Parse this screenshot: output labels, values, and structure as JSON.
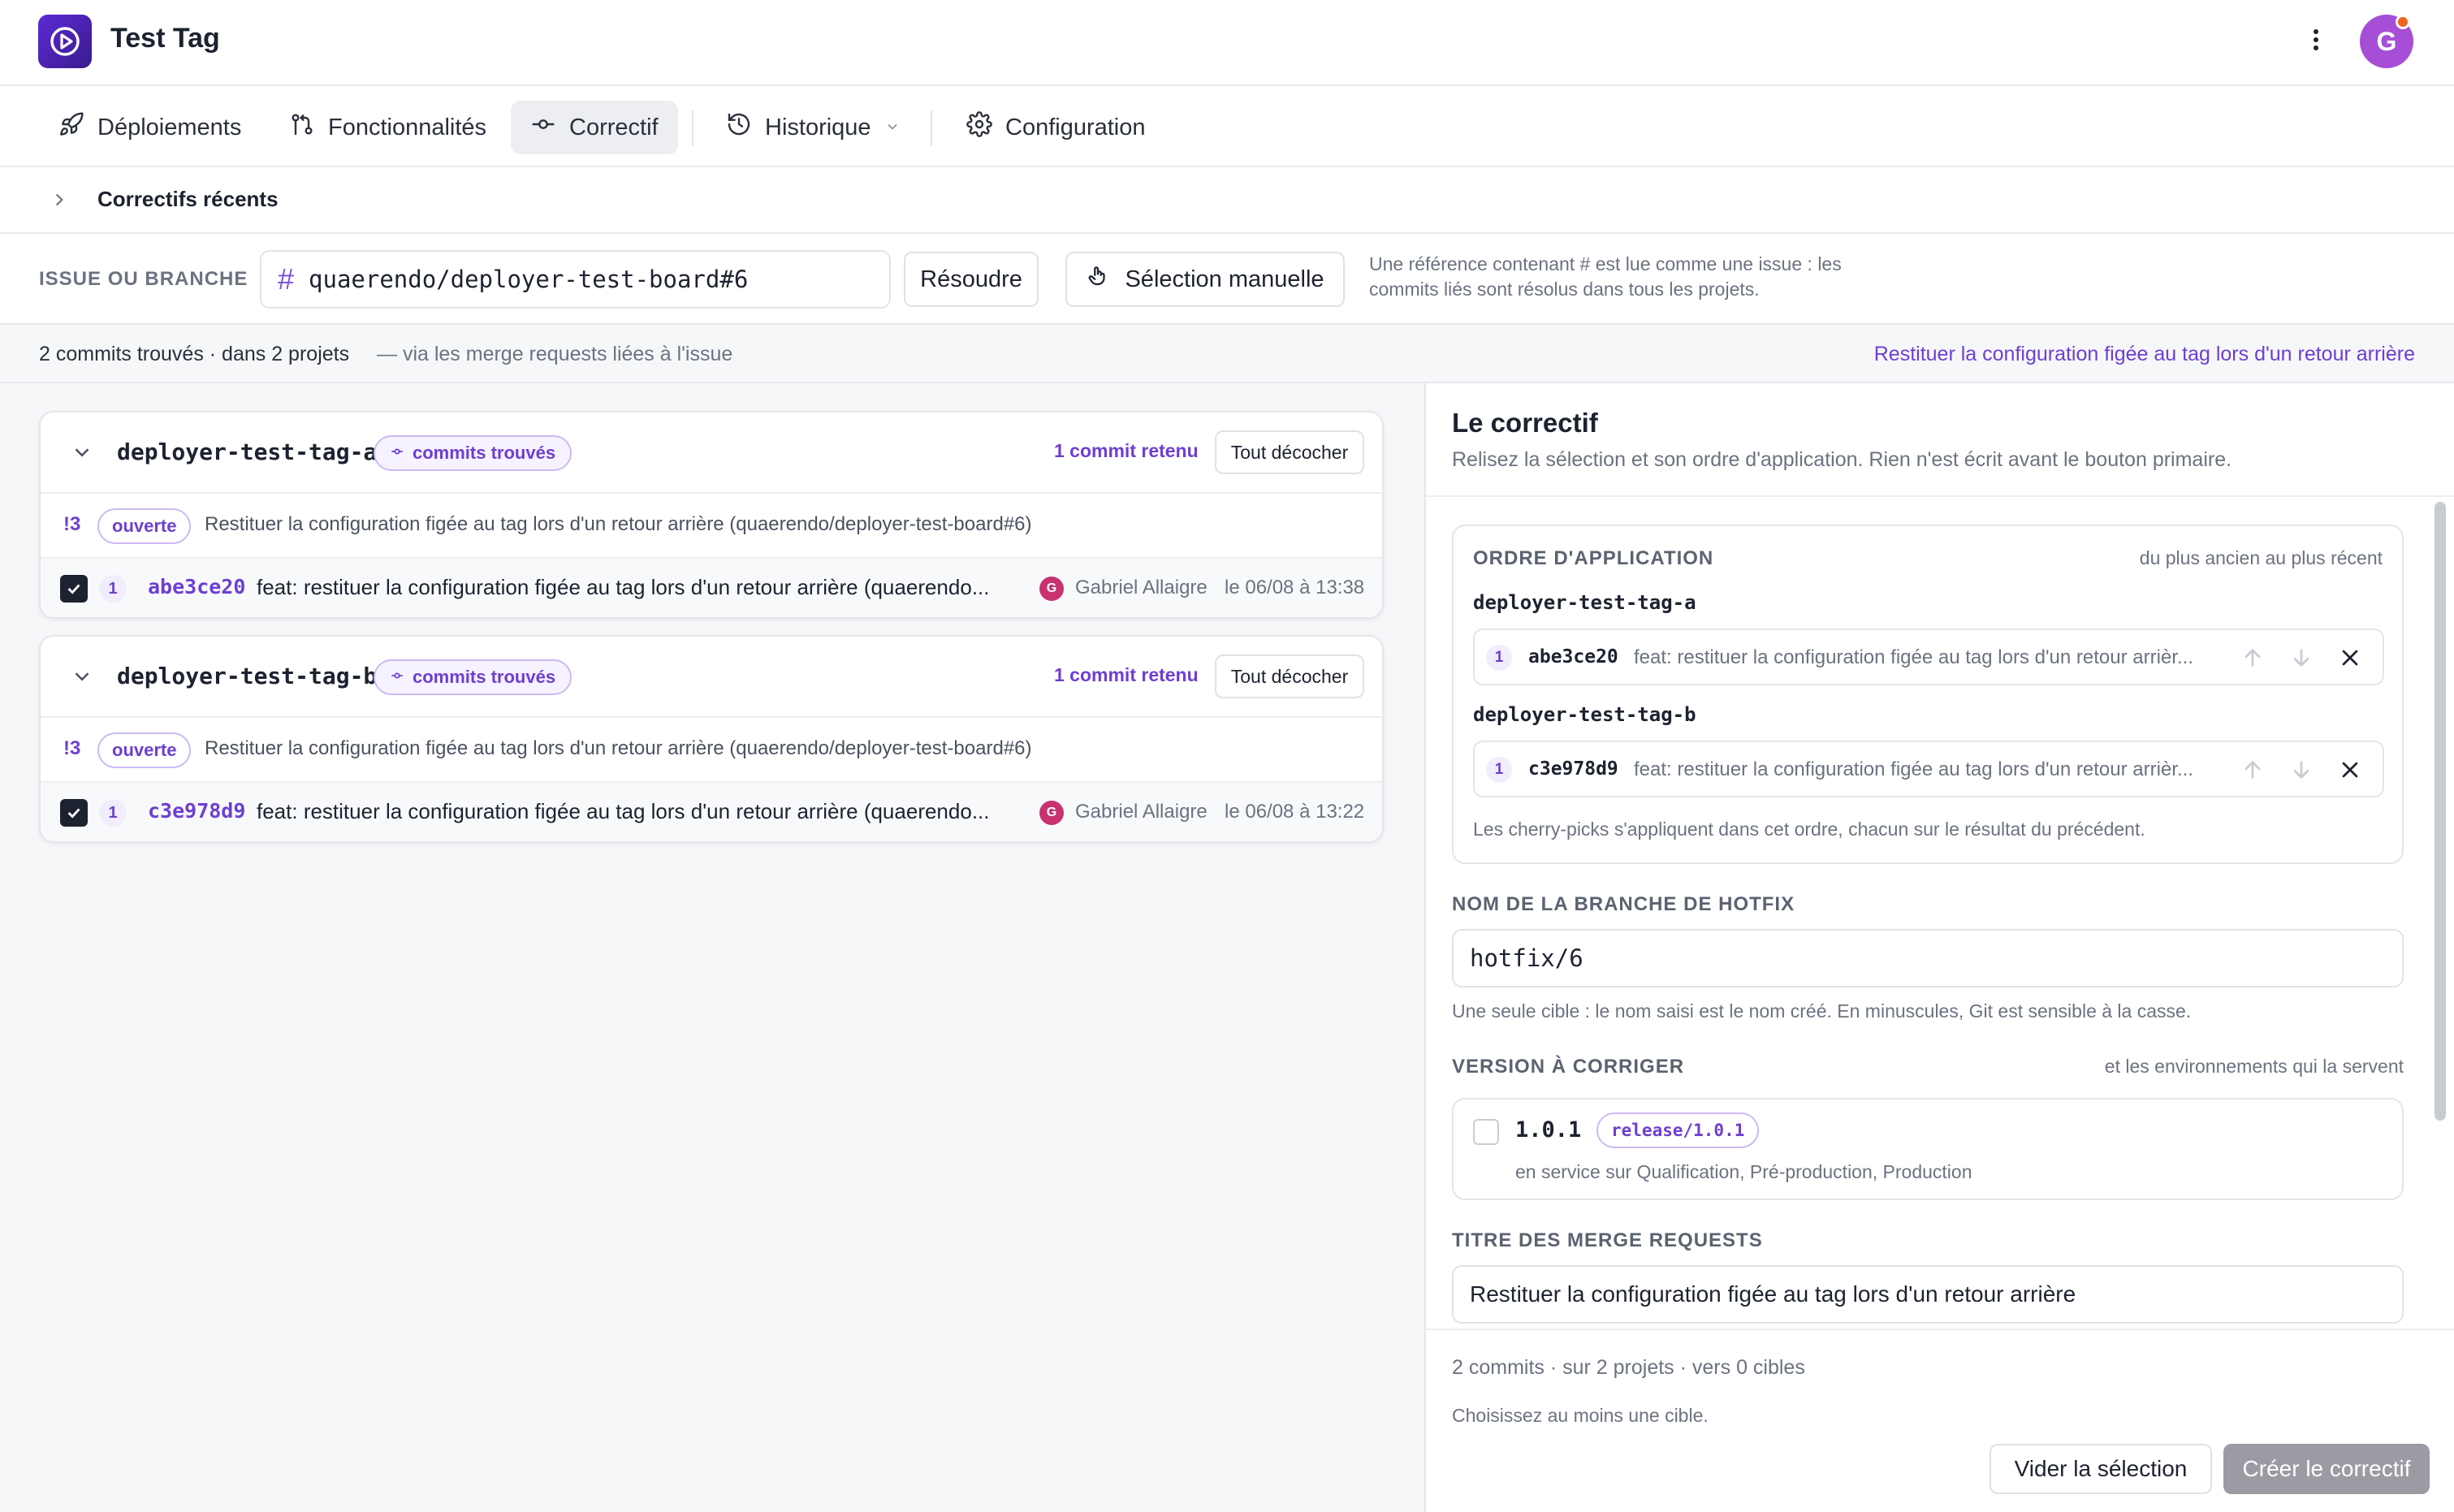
{
  "app": {
    "title": "Test Tag",
    "avatar_initial": "G",
    "colors": {
      "accent": "#6d3fd0",
      "logo": "#5b2bd6",
      "avatar": "#a64fd6",
      "notification": "#f0641e"
    }
  },
  "nav": {
    "items": [
      {
        "label": "Déploiements",
        "icon": "rocket-icon"
      },
      {
        "label": "Fonctionnalités",
        "icon": "git-branch-icon"
      },
      {
        "label": "Correctif",
        "icon": "commit-icon",
        "active": true
      },
      {
        "label": "Historique",
        "icon": "history-icon",
        "has_dropdown": true
      },
      {
        "label": "Configuration",
        "icon": "gear-icon"
      }
    ]
  },
  "recent": {
    "label": "Correctifs récents"
  },
  "issue": {
    "label": "ISSUE OU BRANCHE",
    "value": "quaerendo/deployer-test-board#6",
    "resolve_label": "Résoudre",
    "manual_label": "Sélection manuelle",
    "help_line1": "Une référence contenant # est lue comme une issue : les",
    "help_line2": "commits liés sont résolus dans tous les projets."
  },
  "summary": {
    "text": "2 commits trouvés · dans 2 projets",
    "via": "—    via les merge requests liées à l'issue",
    "link": "Restituer la configuration figée au tag lors d'un retour arrière"
  },
  "projects": [
    {
      "name": "deployer-test-tag-a",
      "badge": "commits trouvés",
      "retained": "1 commit retenu",
      "uncheck_label": "Tout décocher",
      "mr": {
        "num": "!3",
        "status": "ouverte",
        "title": "Restituer la configuration figée au tag lors d'un retour arrière (quaerendo/deployer-test-board#6)"
      },
      "commit": {
        "order": "1",
        "sha": "abe3ce20",
        "message": "feat: restituer la configuration figée au tag lors d'un retour arrière (quaerendo...",
        "author_initial": "G",
        "author": "Gabriel Allaigre",
        "date": "le 06/08 à 13:38",
        "checked": true
      }
    },
    {
      "name": "deployer-test-tag-b",
      "badge": "commits trouvés",
      "retained": "1 commit retenu",
      "uncheck_label": "Tout décocher",
      "mr": {
        "num": "!3",
        "status": "ouverte",
        "title": "Restituer la configuration figée au tag lors d'un retour arrière (quaerendo/deployer-test-board#6)"
      },
      "commit": {
        "order": "1",
        "sha": "c3e978d9",
        "message": "feat: restituer la configuration figée au tag lors d'un retour arrière (quaerendo...",
        "author_initial": "G",
        "author": "Gabriel Allaigre",
        "date": "le 06/08 à 13:22",
        "checked": true
      }
    }
  ],
  "fix": {
    "title": "Le correctif",
    "subtitle": "Relisez la sélection et son ordre d'application. Rien n'est écrit avant le bouton primaire.",
    "order": {
      "label": "ORDRE D'APPLICATION",
      "hint": "du plus ancien au plus récent",
      "items": [
        {
          "project": "deployer-test-tag-a",
          "num": "1",
          "sha": "abe3ce20",
          "message": "feat: restituer la configuration figée au tag lors d'un retour arrièr..."
        },
        {
          "project": "deployer-test-tag-b",
          "num": "1",
          "sha": "c3e978d9",
          "message": "feat: restituer la configuration figée au tag lors d'un retour arrièr..."
        }
      ],
      "footer": "Les cherry-picks s'appliquent dans cet ordre, chacun sur le résultat du précédent."
    },
    "branch": {
      "label": "NOM DE LA BRANCHE DE HOTFIX",
      "value": "hotfix/6",
      "help": "Une seule cible : le nom saisi est le nom créé. En minuscules, Git est sensible à la casse."
    },
    "version": {
      "label": "VERSION À CORRIGER",
      "hint": "et les environnements qui la servent",
      "number": "1.0.1",
      "branch": "release/1.0.1",
      "envs": "en service sur Qualification, Pré-production, Production",
      "checked": false
    },
    "mr_title": {
      "label": "TITRE DES MERGE REQUESTS",
      "value": "Restituer la configuration figée au tag lors d'un retour arrière"
    },
    "footer": {
      "stats": "2 commits · sur 2 projets · vers 0 cibles",
      "warning": "Choisissez au moins une cible.",
      "clear_label": "Vider la sélection",
      "create_label": "Créer le correctif"
    }
  }
}
